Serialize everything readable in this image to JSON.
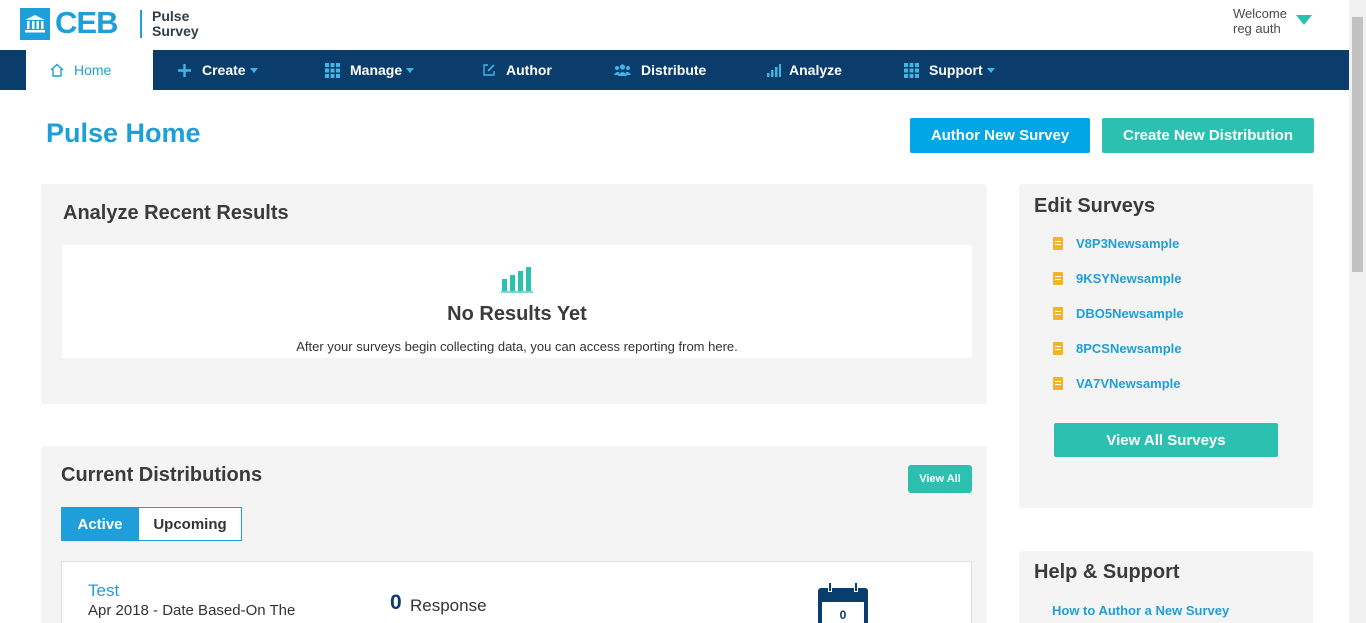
{
  "brand": {
    "name": "CEB",
    "product_line1": "Pulse",
    "product_line2": "Survey"
  },
  "user": {
    "welcome": "Welcome",
    "name": "reg auth"
  },
  "nav": {
    "home": "Home",
    "create": "Create",
    "manage": "Manage",
    "author": "Author",
    "distribute": "Distribute",
    "analyze": "Analyze",
    "support": "Support"
  },
  "page": {
    "title": "Pulse Home"
  },
  "actions": {
    "author_new": "Author New Survey",
    "create_dist": "Create New Distribution"
  },
  "analyze": {
    "title": "Analyze Recent Results",
    "empty_title": "No Results Yet",
    "empty_text": "After your surveys begin collecting data, you can access reporting from here."
  },
  "edit_surveys": {
    "title": "Edit Surveys",
    "items": [
      "V8P3Newsample",
      "9KSYNewsample",
      "DBO5Newsample",
      "8PCSNewsample",
      "VA7VNewsample"
    ],
    "view_all": "View All Surveys"
  },
  "distributions": {
    "title": "Current Distributions",
    "view_all": "View All",
    "tabs": [
      "Active",
      "Upcoming"
    ],
    "item": {
      "name": "Test",
      "sub": "Apr 2018 - Date Based-On The",
      "count": "0",
      "count_label": "Response",
      "cal_value": "0"
    }
  },
  "help": {
    "title": "Help & Support",
    "link1": "How to Author a New Survey"
  },
  "colors": {
    "accent": "#1f9fd9",
    "teal": "#2cc0b0",
    "nav": "#0a3d6b"
  }
}
